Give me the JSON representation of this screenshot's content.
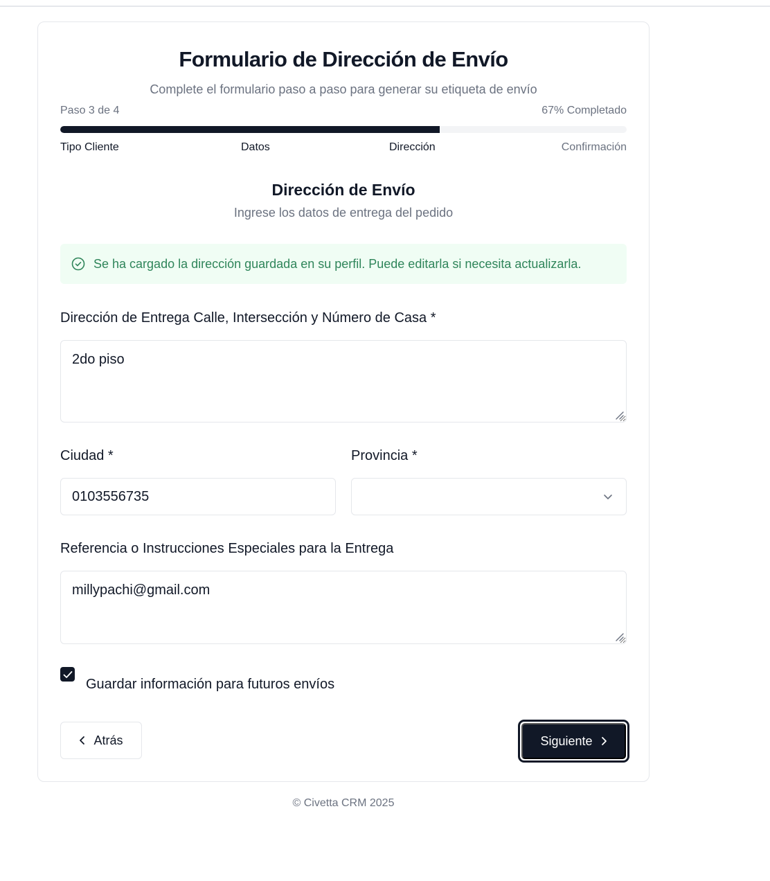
{
  "header": {
    "title": "Formulario de Dirección de Envío",
    "subtitle": "Complete el formulario paso a paso para generar su etiqueta de envío"
  },
  "progress": {
    "step_text": "Paso 3 de 4",
    "percent_text": "67% Completado",
    "percent": 67,
    "steps": [
      {
        "label": "Tipo Cliente",
        "state": "done"
      },
      {
        "label": "Datos",
        "state": "done"
      },
      {
        "label": "Dirección",
        "state": "current"
      },
      {
        "label": "Confirmación",
        "state": "pending"
      }
    ]
  },
  "section": {
    "title": "Dirección de Envío",
    "subtitle": "Ingrese los datos de entrega del pedido"
  },
  "alert": {
    "message": "Se ha cargado la dirección guardada en su perfil. Puede editarla si necesita actualizarla.",
    "icon": "check-circle-icon",
    "color": "#2f855a"
  },
  "form": {
    "address": {
      "label": "Dirección de Entrega Calle, Intersección y Número de Casa *",
      "value": "2do piso"
    },
    "city": {
      "label": "Ciudad *",
      "value": "0103556735"
    },
    "province": {
      "label": "Provincia *",
      "value": ""
    },
    "reference": {
      "label": "Referencia o Instrucciones Especiales para la Entrega",
      "value": "millypachi@gmail.com"
    },
    "save_info": {
      "label": "Guardar información para futuros envíos",
      "checked": true
    }
  },
  "actions": {
    "back_label": "Atrás",
    "next_label": "Siguiente"
  },
  "footer": {
    "text": "© Civetta CRM 2025"
  },
  "colors": {
    "primary": "#111827",
    "muted": "#6b7280",
    "border": "#e5e7eb",
    "success": "#2f855a"
  }
}
